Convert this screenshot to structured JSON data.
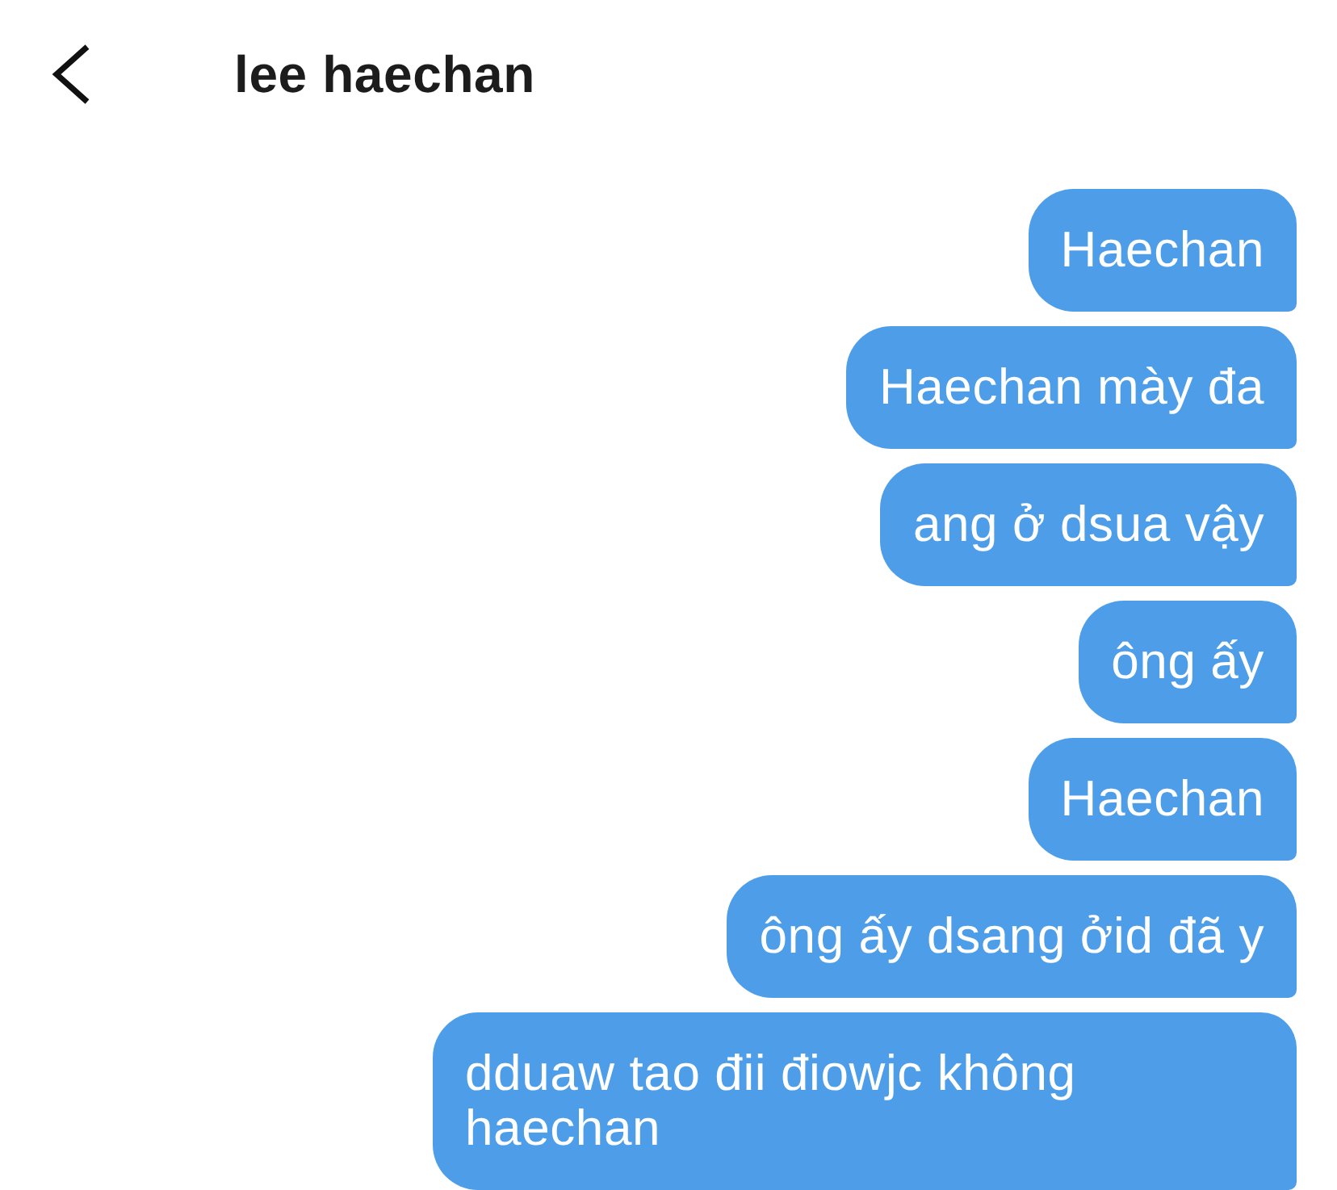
{
  "header": {
    "title": "lee haechan"
  },
  "messages": [
    {
      "text": "Haechan"
    },
    {
      "text": "Haechan mày đa"
    },
    {
      "text": "ang ở dsua vậy"
    },
    {
      "text": "ông ấy"
    },
    {
      "text": "Haechan"
    },
    {
      "text": "ông ấy dsang ởid đã y"
    },
    {
      "text": "dduaw tao đii điowjc không haechan"
    }
  ]
}
